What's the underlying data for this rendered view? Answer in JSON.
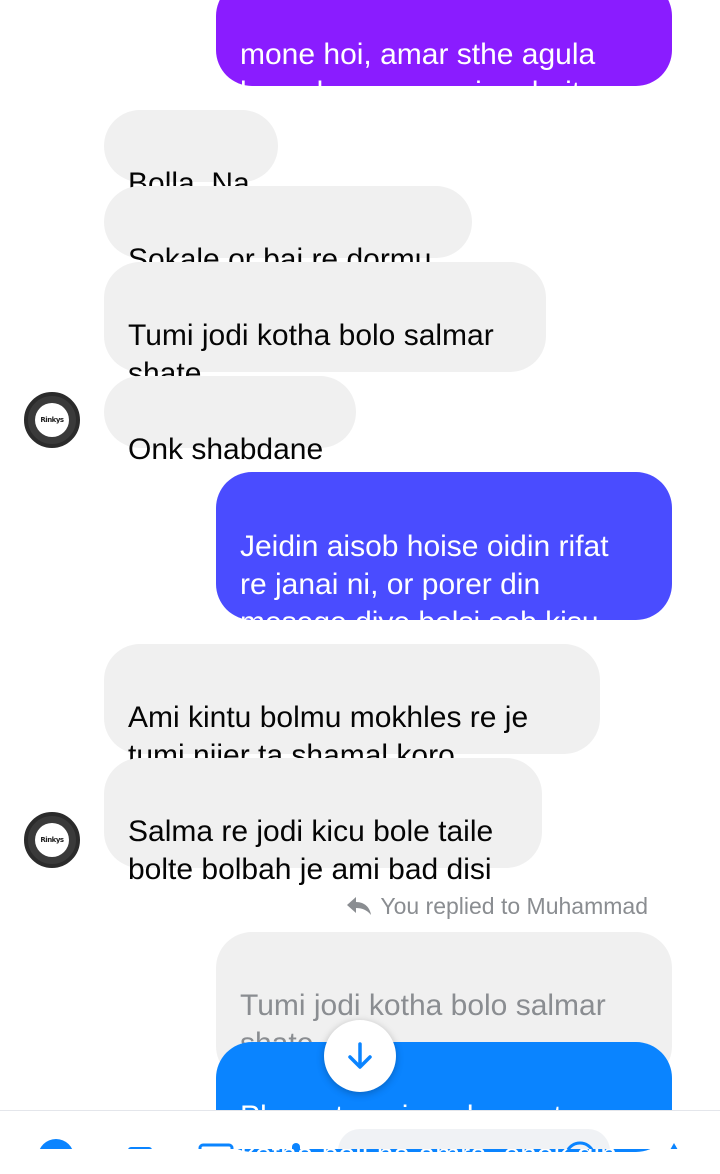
{
  "messages": [
    {
      "id": "m1",
      "direction": "sent",
      "text": "mone hoi, amar sthe agula\nkorar karone, genjam hoito"
    },
    {
      "id": "m2",
      "direction": "received",
      "text": "Bolla. Na"
    },
    {
      "id": "m3",
      "direction": "received",
      "text": "Sokale or bai re dormu"
    },
    {
      "id": "m4",
      "direction": "received",
      "text": "Tumi jodi kotha bolo salmar\nshate"
    },
    {
      "id": "m5",
      "direction": "received",
      "text": "Onk shabdane"
    },
    {
      "id": "m6",
      "direction": "sent",
      "text": "Jeidin aisob hoise oidin rifat\nre janai ni, or porer din\nmesege diye bolsi sob kisu,,"
    },
    {
      "id": "m7",
      "direction": "received",
      "text": "Ami kintu bolmu mokhles re je\ntumi nijer ta shamal koro"
    },
    {
      "id": "m8",
      "direction": "received",
      "text": "Salma re jodi kicu bole taile\nbolte bolbah je ami bad disi"
    },
    {
      "id": "m9",
      "direction": "sent",
      "text": "Phone  to nai ar class a to\nkotha boli na amra, onek din"
    }
  ],
  "reply": {
    "hint": "You replied to Muhammad",
    "quoted": "Tumi jodi kotha bolo salmar\nshate"
  },
  "avatar": {
    "label": "Rinkys"
  },
  "icons": {
    "reply": "reply-arrow-icon",
    "scroll": "arrow-down-icon"
  },
  "colors": {
    "sent_purple": "#8a1cff",
    "sent_indigo": "#4a4cff",
    "sent_blue": "#0a84ff",
    "received": "#f0f0f0",
    "quoted": "#f0f0f0"
  }
}
